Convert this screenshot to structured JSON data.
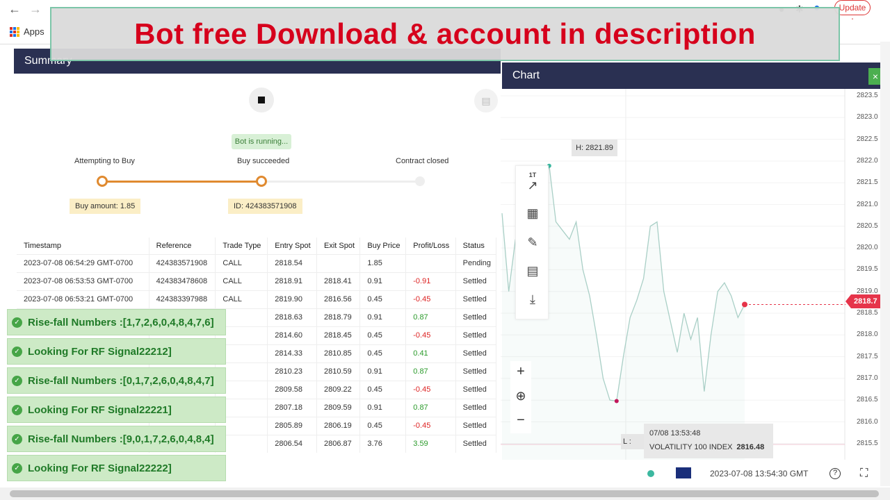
{
  "browser": {
    "update_label": "Update",
    "bookmarks_apps": "Apps"
  },
  "banner": {
    "text": "Bot free Download & account in description"
  },
  "summary": {
    "title": "Summary",
    "status": "Bot is running...",
    "steps": [
      "Attempting to Buy",
      "Buy succeeded",
      "Contract closed"
    ],
    "buy_amount": "Buy amount: 1.85",
    "contract_id": "ID: 424383571908",
    "table": {
      "headers": [
        "Timestamp",
        "Reference",
        "Trade Type",
        "Entry Spot",
        "Exit Spot",
        "Buy Price",
        "Profit/Loss",
        "Status"
      ],
      "rows": [
        [
          "2023-07-08 06:54:29 GMT-0700",
          "424383571908",
          "CALL",
          "2818.54",
          "",
          "1.85",
          "",
          "Pending"
        ],
        [
          "2023-07-08 06:53:53 GMT-0700",
          "424383478608",
          "CALL",
          "2818.91",
          "2818.41",
          "0.91",
          "-0.91",
          "Settled"
        ],
        [
          "2023-07-08 06:53:21 GMT-0700",
          "424383397988",
          "CALL",
          "2819.90",
          "2816.56",
          "0.45",
          "-0.45",
          "Settled"
        ],
        [
          "",
          "",
          "",
          "2818.63",
          "2818.79",
          "0.91",
          "0.87",
          "Settled"
        ],
        [
          "",
          "",
          "",
          "2814.60",
          "2818.45",
          "0.45",
          "-0.45",
          "Settled"
        ],
        [
          "",
          "",
          "",
          "2814.33",
          "2810.85",
          "0.45",
          "0.41",
          "Settled"
        ],
        [
          "",
          "",
          "",
          "2810.23",
          "2810.59",
          "0.91",
          "0.87",
          "Settled"
        ],
        [
          "",
          "",
          "",
          "2809.58",
          "2809.22",
          "0.45",
          "-0.45",
          "Settled"
        ],
        [
          "",
          "",
          "",
          "2807.18",
          "2809.59",
          "0.91",
          "0.87",
          "Settled"
        ],
        [
          "",
          "",
          "",
          "2805.89",
          "2806.19",
          "0.45",
          "-0.45",
          "Settled"
        ],
        [
          "",
          "",
          "",
          "2806.54",
          "2806.87",
          "3.76",
          "3.59",
          "Settled"
        ]
      ]
    }
  },
  "alerts": [
    "Rise-fall Numbers :[1,7,2,6,0,4,8,4,7,6]",
    "Looking For RF Signal22212]",
    "Rise-fall Numbers :[0,1,7,2,6,0,4,8,4,7]",
    "Looking For RF Signal22221]",
    "Rise-fall Numbers :[9,0,1,7,2,6,0,4,8,4]",
    "Looking For RF Signal22222]"
  ],
  "chart": {
    "title": "Chart",
    "tool_tick_label": "1T",
    "y_ticks": [
      "2823.5",
      "2823.0",
      "2822.5",
      "2822.0",
      "2821.5",
      "2821.0",
      "2820.5",
      "2820.0",
      "2819.5",
      "2819.0",
      "2818.5",
      "2818.0",
      "2817.5",
      "2817.0",
      "2816.5",
      "2816.0",
      "2815.5"
    ],
    "high_label": "H: 2821.89",
    "low_label": "L : 2816.48",
    "current_price": "2818.7",
    "crosshair_time": "07/08 13:53:48",
    "crosshair_symbol": "VOLATILITY 100 INDEX",
    "crosshair_value": "2816.48",
    "footer_time": "2023-07-08 13:54:30 GMT",
    "chart_data": {
      "type": "line",
      "ylim": [
        2815.4,
        2823.7
      ],
      "y": [
        2820.8,
        2819.0,
        2820.2,
        2819.6,
        2820.5,
        2820.3,
        2821.3,
        2821.89,
        2820.6,
        2820.4,
        2820.2,
        2820.6,
        2819.5,
        2818.9,
        2818.0,
        2817.0,
        2816.5,
        2816.48,
        2817.5,
        2818.4,
        2818.8,
        2819.3,
        2820.5,
        2820.6,
        2819.0,
        2818.3,
        2817.6,
        2818.5,
        2817.9,
        2818.4,
        2816.7,
        2818.0,
        2819.0,
        2819.2,
        2818.9,
        2818.4,
        2818.7
      ]
    }
  }
}
